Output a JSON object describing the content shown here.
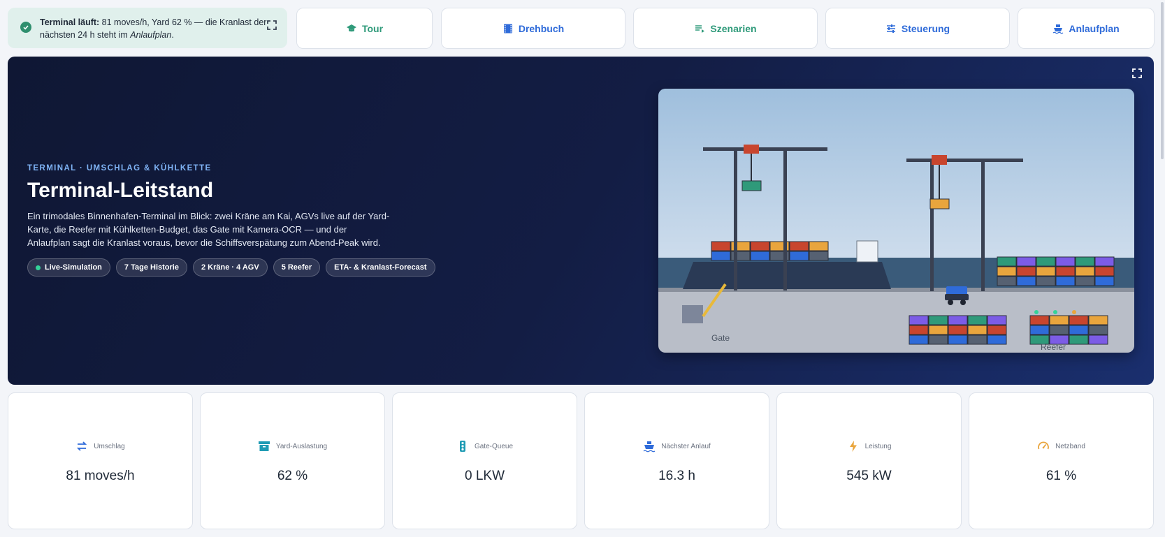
{
  "status": {
    "strong": "Terminal läuft:",
    "text": " 81 moves/h, Yard 62 % — die Kranlast der nächsten 24 h steht im ",
    "emph": "Anlaufplan",
    "end": "."
  },
  "nav": {
    "tour": "Tour",
    "drehbuch": "Drehbuch",
    "szenarien": "Szenarien",
    "steuerung": "Steuerung",
    "anlaufplan": "Anlaufplan"
  },
  "hero": {
    "eyebrow": "TERMINAL · UMSCHLAG & KÜHLKETTE",
    "title": "Terminal-Leitstand",
    "description": "Ein trimodales Binnenhafen-Terminal im Blick: zwei Kräne am Kai, AGVs live auf der Yard-Karte, die Reefer mit Kühlketten-Budget, das Gate mit Kamera-OCR — und der Anlaufplan sagt die Kranlast voraus, bevor die Schiffsverspätung zum Abend-Peak wird.",
    "chips": [
      "Live-Simulation",
      "7 Tage Historie",
      "2 Kräne · 4 AGV",
      "5 Reefer",
      "ETA- & Kranlast-Forecast"
    ]
  },
  "scene": {
    "gate_label": "Gate",
    "reefer_label": "Reefer"
  },
  "kpis": [
    {
      "label": "Umschlag",
      "value": "81 moves/h",
      "icon": "swap-icon"
    },
    {
      "label": "Yard-Auslastung",
      "value": "62 %",
      "icon": "archive-icon"
    },
    {
      "label": "Gate-Queue",
      "value": "0 LKW",
      "icon": "traffic-light-icon"
    },
    {
      "label": "Nächster Anlauf",
      "value": "16.3 h",
      "icon": "ship-icon"
    },
    {
      "label": "Leistung",
      "value": "545 kW",
      "icon": "bolt-icon"
    },
    {
      "label": "Netzband",
      "value": "61 %",
      "icon": "gauge-icon"
    }
  ],
  "colors": {
    "accent": "#2f6bd9",
    "tour": "#2f9a7a",
    "hero_bg": "#131d44"
  }
}
